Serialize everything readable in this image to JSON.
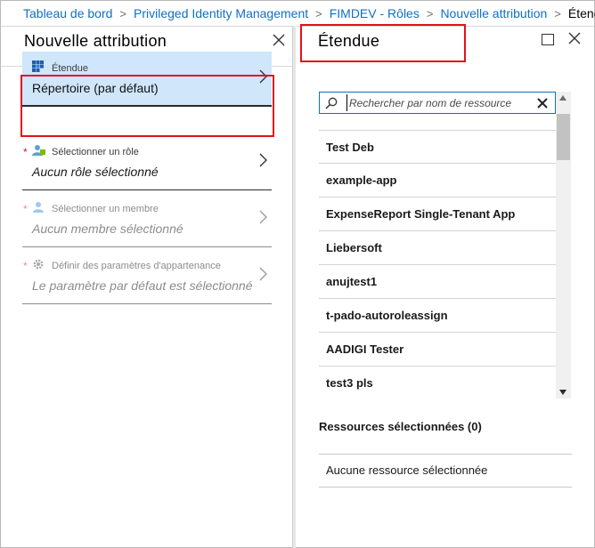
{
  "breadcrumb": {
    "items": [
      "Tableau de bord",
      "Privileged Identity Management",
      "FIMDEV - Rôles",
      "Nouvelle attribution"
    ],
    "current": "Étendue",
    "separator": ">"
  },
  "left_blade": {
    "title": "Nouvelle attribution",
    "steps": [
      {
        "label": "Étendue",
        "value": "Répertoire (par défaut)",
        "required": false,
        "state": "active",
        "icon": "scope-grid-icon"
      },
      {
        "label": "Sélectionner un rôle",
        "value": "Aucun rôle sélectionné",
        "required": true,
        "state": "enabled",
        "icon": "role-icon"
      },
      {
        "label": "Sélectionner un membre",
        "value": "Aucun membre sélectionné",
        "required": true,
        "state": "disabled",
        "icon": "member-icon"
      },
      {
        "label": "Définir des paramètres d'appartenance",
        "value": "Le paramètre par défaut est sélectionné",
        "required": true,
        "state": "disabled",
        "icon": "gear-icon"
      }
    ]
  },
  "right_blade": {
    "title": "Étendue",
    "search": {
      "placeholder": "Rechercher par nom de ressource",
      "value": ""
    },
    "resources": [
      "Test Deb",
      "example-app",
      "ExpenseReport Single-Tenant App",
      "Liebersoft",
      "anujtest1",
      "t-pado-autoroleassign",
      "AADIGI Tester",
      "test3 pls"
    ],
    "selected_title": "Ressources sélectionnées (0)",
    "selected_empty": "Aucune ressource sélectionnée"
  },
  "colors": {
    "link": "#0f6fc6",
    "active_step_bg": "#cfe6fb",
    "highlight_box": "#e0131d",
    "required_star": "#e81123"
  }
}
